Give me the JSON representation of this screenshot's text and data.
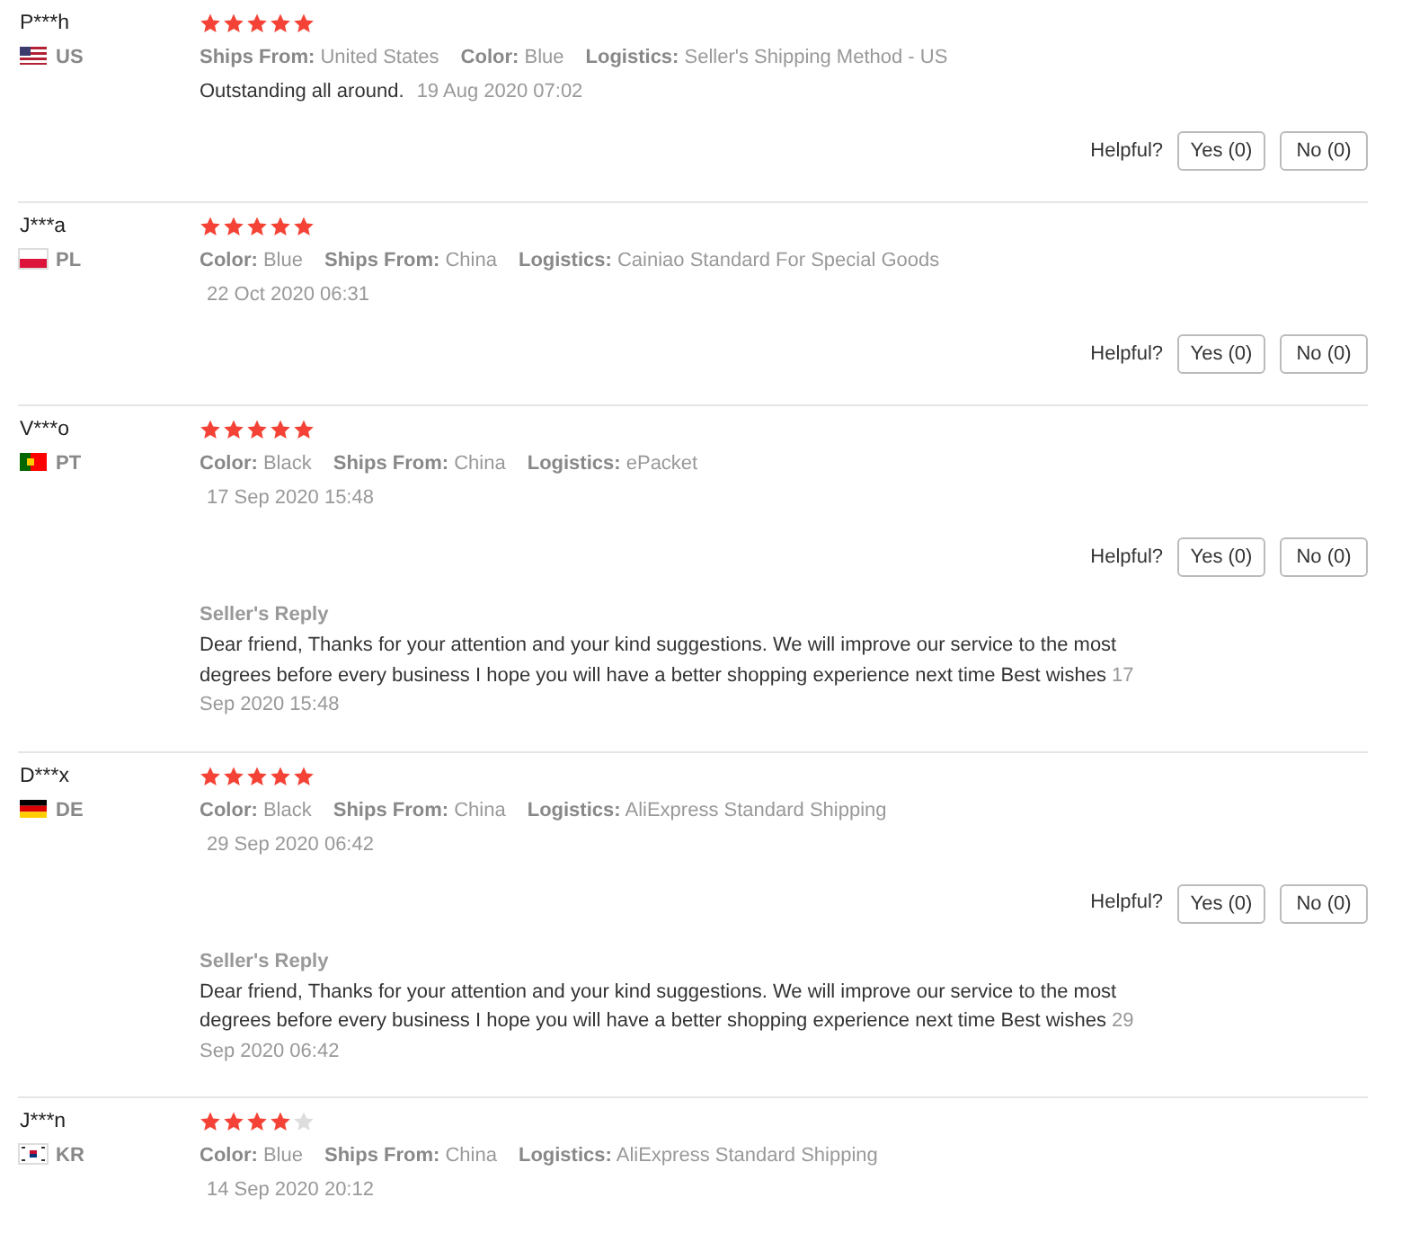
{
  "reviews": [
    {
      "name": "P***h",
      "country": "US",
      "kind": "us",
      "stars": 5,
      "attributes": [
        {
          "label": "Ships From:",
          "value": "United States"
        },
        {
          "label": "Color:",
          "value": "Blue"
        },
        {
          "label": "Logistics:",
          "value": "Seller's Shipping Method - US"
        }
      ],
      "comment": "Outstanding all around.",
      "date": "19 Aug 2020 07:02",
      "helpful": {
        "label": "Helpful?",
        "yes": "Yes (0)",
        "no": "No (0)"
      }
    },
    {
      "name": "J***a",
      "country": "PL",
      "kind": "pl",
      "stars": 5,
      "attributes": [
        {
          "label": "Color:",
          "value": "Blue"
        },
        {
          "label": "Ships From:",
          "value": "China"
        },
        {
          "label": "Logistics:",
          "value": "Cainiao Standard For Special Goods"
        }
      ],
      "date": "22 Oct 2020 06:31",
      "helpful": {
        "label": "Helpful?",
        "yes": "Yes (0)",
        "no": "No (0)"
      }
    },
    {
      "name": "V***o",
      "country": "PT",
      "kind": "pt",
      "stars": 5,
      "attributes": [
        {
          "label": "Color:",
          "value": "Black"
        },
        {
          "label": "Ships From:",
          "value": "China"
        },
        {
          "label": "Logistics:",
          "value": "ePacket"
        }
      ],
      "date": "17 Sep 2020 15:48",
      "helpful": {
        "label": "Helpful?",
        "yes": "Yes (0)",
        "no": "No (0)"
      },
      "seller_reply": {
        "title": "Seller's Reply",
        "text": "Dear friend, Thanks for your attention and your kind suggestions. We will improve our service to the most degrees before every business I hope you will have a better shopping experience next time Best wishes",
        "date": "17 Sep 2020 15:48"
      }
    },
    {
      "name": "D***x",
      "country": "DE",
      "kind": "de",
      "stars": 5,
      "attributes": [
        {
          "label": "Color:",
          "value": "Black"
        },
        {
          "label": "Ships From:",
          "value": "China"
        },
        {
          "label": "Logistics:",
          "value": "AliExpress Standard Shipping"
        }
      ],
      "date": "29 Sep 2020 06:42",
      "helpful": {
        "label": "Helpful?",
        "yes": "Yes (0)",
        "no": "No (0)"
      },
      "seller_reply": {
        "title": "Seller's Reply",
        "text": "Dear friend, Thanks for your attention and your kind suggestions. We will improve our service to the most degrees before every business I hope you will have a better shopping experience next time Best wishes",
        "date": "29 Sep 2020 06:42"
      }
    },
    {
      "name": "J***n",
      "country": "KR",
      "kind": "kr",
      "stars": 4,
      "attributes": [
        {
          "label": "Color:",
          "value": "Blue"
        },
        {
          "label": "Ships From:",
          "value": "China"
        },
        {
          "label": "Logistics:",
          "value": "AliExpress Standard Shipping"
        }
      ],
      "date": "14 Sep 2020 20:12"
    }
  ]
}
